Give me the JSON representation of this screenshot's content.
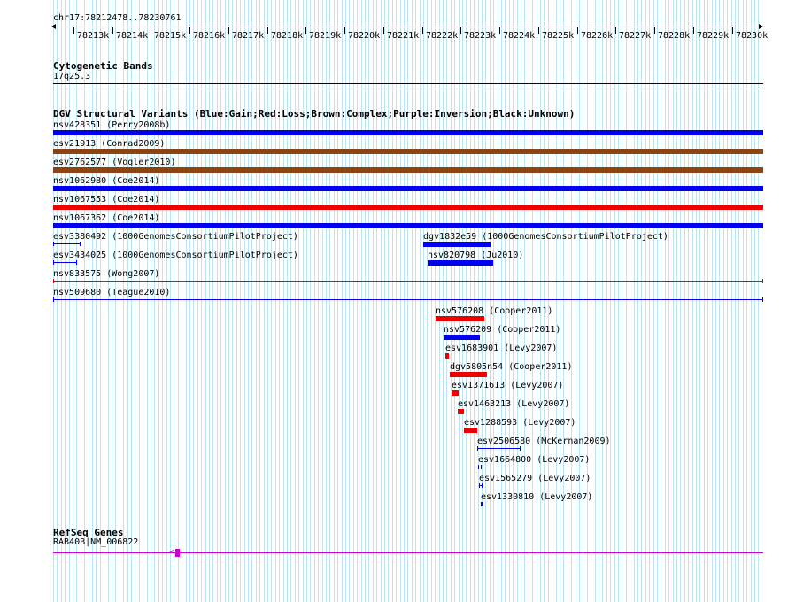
{
  "track_region": "chr17:78212478..78230761",
  "ruler_ticks": [
    "78213k",
    "78214k",
    "78215k",
    "78216k",
    "78217k",
    "78218k",
    "78219k",
    "78220k",
    "78221k",
    "78222k",
    "78223k",
    "78224k",
    "78225k",
    "78226k",
    "78227k",
    "78228k",
    "78229k",
    "78230k"
  ],
  "cytogenetic": {
    "title": "Cytogenetic Bands",
    "band": "17q25.3"
  },
  "dgv": {
    "title": "DGV Structural Variants (Blue:Gain;Red:Loss;Brown:Complex;Purple:Inversion;Black:Unknown)",
    "colors": {
      "gain": "#0000ee",
      "loss": "#ee0000",
      "complex": "#8b4513",
      "inversion": "#800080",
      "unknown": "#000000"
    },
    "variants": [
      {
        "label": "nsv428351 (Perry2008b)",
        "type": "gain",
        "style": "thick"
      },
      {
        "label": "esv21913 (Conrad2009)",
        "type": "complex",
        "style": "thick"
      },
      {
        "label": "esv2762577 (Vogler2010)",
        "type": "complex",
        "style": "thick"
      },
      {
        "label": "nsv1062980 (Coe2014)",
        "type": "gain",
        "style": "thick"
      },
      {
        "label": "nsv1067553 (Coe2014)",
        "type": "loss",
        "style": "thick"
      },
      {
        "label": "nsv1067362 (Coe2014)",
        "type": "gain",
        "style": "thick"
      },
      {
        "label": "esv3380492 (1000GenomesConsortiumPilotProject)",
        "type": "gain",
        "style": "thin"
      },
      {
        "label": "dgv1832e59 (1000GenomesConsortiumPilotProject)",
        "type": "gain",
        "style": "thick"
      },
      {
        "label": "esv3434025 (1000GenomesConsortiumPilotProject)",
        "type": "gain",
        "style": "thin"
      },
      {
        "label": "nsv820798 (Ju2010)",
        "type": "gain",
        "style": "thick"
      },
      {
        "label": "nsv833575 (Wong2007)",
        "type": "loss",
        "style": "thin"
      },
      {
        "label": "nsv509680 (Teague2010)",
        "type": "gain",
        "style": "thin"
      },
      {
        "label": "nsv576208 (Cooper2011)",
        "type": "loss",
        "style": "thick"
      },
      {
        "label": "nsv576209 (Cooper2011)",
        "type": "gain",
        "style": "thick"
      },
      {
        "label": "esv1683901 (Levy2007)",
        "type": "loss",
        "style": "thick"
      },
      {
        "label": "dgv5805n54 (Cooper2011)",
        "type": "loss",
        "style": "thick"
      },
      {
        "label": "esv1371613 (Levy2007)",
        "type": "loss",
        "style": "thick"
      },
      {
        "label": "esv1463213 (Levy2007)",
        "type": "loss",
        "style": "thick"
      },
      {
        "label": "esv1288593 (Levy2007)",
        "type": "loss",
        "style": "thick"
      },
      {
        "label": "esv2506580 (McKernan2009)",
        "type": "gain",
        "style": "thin"
      },
      {
        "label": "esv1664800 (Levy2007)",
        "type": "gain",
        "style": "thin"
      },
      {
        "label": "esv1565279 (Levy2007)",
        "type": "gain",
        "style": "thin"
      },
      {
        "label": "esv1330810 (Levy2007)",
        "type": "gain",
        "style": "thin"
      }
    ]
  },
  "refseq": {
    "title": "RefSeq Genes",
    "gene_label": "RAB40B|NM_006822",
    "color": "#cc00cc"
  }
}
